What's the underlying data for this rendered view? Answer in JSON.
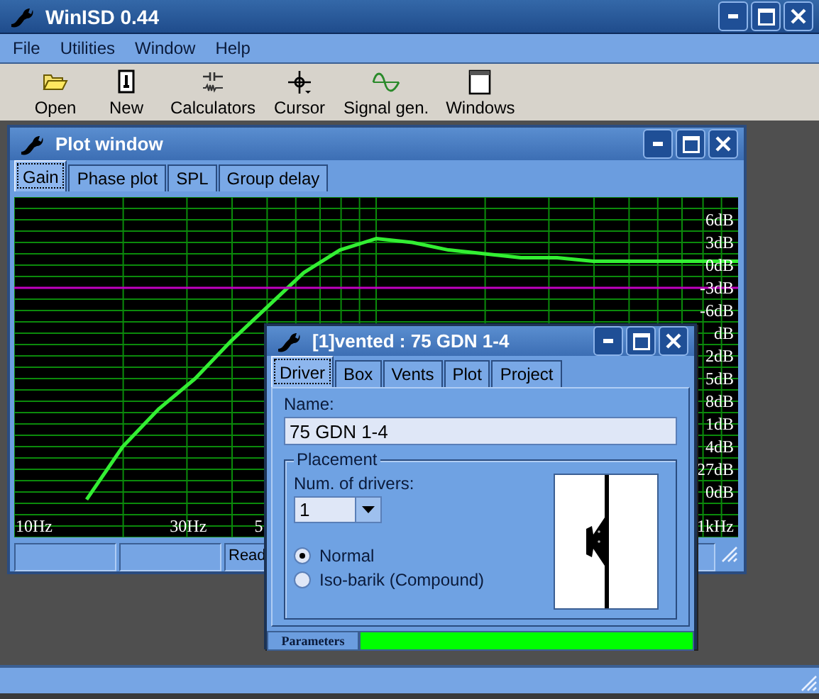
{
  "main_window": {
    "title": "WinISD 0.44"
  },
  "menu": [
    "File",
    "Utilities",
    "Window",
    "Help"
  ],
  "toolbar": [
    {
      "label": "Open",
      "kind": "folder"
    },
    {
      "label": "New",
      "kind": "document"
    },
    {
      "label": "Calculators",
      "kind": "calculator"
    },
    {
      "label": "Cursor",
      "kind": "crosshair"
    },
    {
      "label": "Signal gen.",
      "kind": "wave"
    },
    {
      "label": "Windows",
      "kind": "window"
    }
  ],
  "plot_window": {
    "title": "Plot window",
    "tabs": [
      {
        "label": "Gain",
        "selected": true
      },
      {
        "label": "Phase plot",
        "selected": false
      },
      {
        "label": "SPL",
        "selected": false
      },
      {
        "label": "Group delay",
        "selected": false
      }
    ],
    "chart_data": {
      "type": "line",
      "series": [
        {
          "color": "#33ee33",
          "values": [
            null,
            null,
            -31,
            -24,
            -19,
            -15,
            -10,
            -5.5,
            -1,
            2,
            3.5,
            3,
            2,
            1.5,
            1,
            1,
            0.5,
            0.5,
            0.5,
            0.5,
            0.5
          ]
        },
        {
          "color": "#c000c0",
          "values": [
            -3,
            -3,
            -3,
            -3,
            -3,
            -3,
            -3,
            -3,
            -3,
            -3,
            -3,
            -3,
            -3,
            -3,
            -3,
            -3,
            -3,
            -3,
            -3,
            -3,
            -3
          ]
        }
      ],
      "ylim": [
        -36,
        9
      ],
      "grid": true,
      "yticks": [
        {
          "value": 6,
          "label": "6dB"
        },
        {
          "value": 3,
          "label": "3dB"
        },
        {
          "value": 0,
          "label": "0dB"
        },
        {
          "value": -3,
          "label": "-3dB"
        },
        {
          "value": -6,
          "label": "-6dB"
        }
      ]
    },
    "frequency_axis_labels": [
      "10Hz",
      "30Hz",
      "5",
      "1kHz"
    ],
    "partly_covered_axis_labels": [
      "dB",
      "2dB",
      "5dB",
      "8dB",
      "1dB",
      "4dB",
      "27dB",
      "0dB"
    ],
    "status_text": "Read"
  },
  "driver_window": {
    "title": "[1]vented : 75 GDN 1-4",
    "tabs": [
      {
        "label": "Driver",
        "selected": true
      },
      {
        "label": "Box",
        "selected": false
      },
      {
        "label": "Vents",
        "selected": false
      },
      {
        "label": "Plot",
        "selected": false
      },
      {
        "label": "Project",
        "selected": false
      }
    ],
    "name_label": "Name:",
    "name_value": "75 GDN 1-4",
    "group_title": "Placement",
    "drivers_label": "Num. of drivers:",
    "drivers_value": "1",
    "placement_options": [
      {
        "label": "Normal",
        "selected": true
      },
      {
        "label": "Iso-barik (Compound)",
        "selected": false
      }
    ],
    "status_label": "Parameters",
    "progress": {
      "level": 1
    }
  }
}
